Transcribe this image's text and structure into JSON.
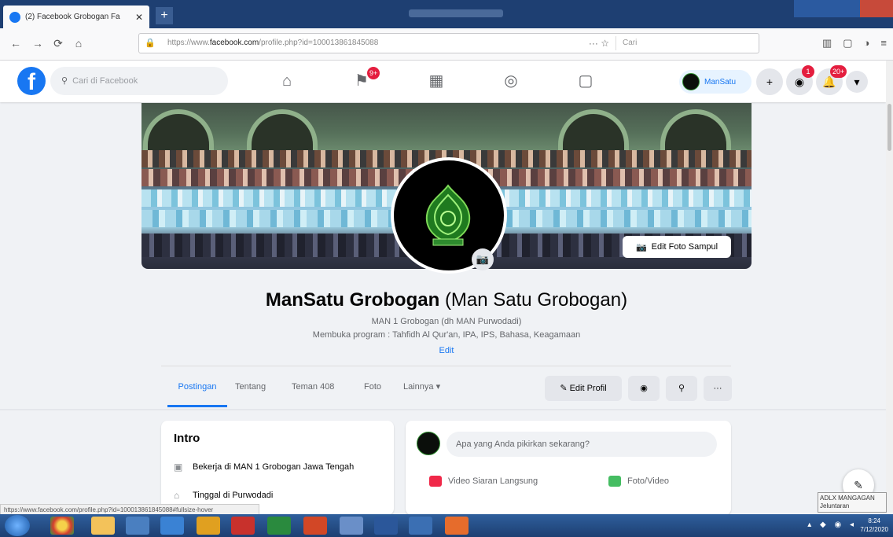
{
  "browser": {
    "tab_title": "(2) Facebook Grobogan Fa",
    "tab_close": "✕",
    "new_tab": "+",
    "url_prefix": "https://www.",
    "url_domain": "facebook.com",
    "url_path": "/profile.php?id=100013861845088",
    "url_more": "··· ☆",
    "search_placeholder": "Cari",
    "back_icon": "←",
    "forward_icon": "→",
    "reload_icon": "⟳",
    "home_icon": "⌂",
    "library_icon": "▥",
    "menu_icon": "≡"
  },
  "facebook": {
    "logo": "f",
    "search_placeholder": "Cari di Facebook",
    "nav": [
      {
        "icon": "home-icon",
        "glyph": "⌂",
        "badge": ""
      },
      {
        "icon": "flag-icon",
        "glyph": "⚑",
        "badge": "9+"
      },
      {
        "icon": "marketplace-icon",
        "glyph": "▦",
        "badge": ""
      },
      {
        "icon": "groups-icon",
        "glyph": "◎",
        "badge": ""
      },
      {
        "icon": "gaming-icon",
        "glyph": "▢",
        "badge": ""
      }
    ],
    "profile_chip_name": "ManSatu",
    "create_icon": "+",
    "messenger_badge": "1",
    "notif_badge": "20+",
    "caret": "▾"
  },
  "profile": {
    "edit_cover": "Edit Foto Sampul",
    "name_bold": "ManSatu Grobogan",
    "name_alt": "(Man Satu Grobogan)",
    "bio_line1": "MAN 1 Grobogan (dh MAN Purwodadi)",
    "bio_line2": "Membuka program : Tahfidh Al Qur'an, IPA, IPS, Bahasa, Keagamaan",
    "bio_edit": "Edit",
    "tabs": [
      "Postingan",
      "Tentang",
      "Teman 408",
      "Foto",
      "Lainnya ▾"
    ],
    "edit_profile": "✎ Edit Profil",
    "view_icon": "◉",
    "search_icon": "⚲",
    "more_icon": "···"
  },
  "intro": {
    "title": "Intro",
    "rows": [
      {
        "glyph": "▣",
        "text": "Bekerja di MAN 1 Grobogan Jawa Tengah"
      },
      {
        "glyph": "⌂",
        "text": "Tinggal di Purwodadi"
      }
    ]
  },
  "composer": {
    "placeholder": "Apa yang Anda pikirkan sekarang?",
    "action_live": "Video Siaran Langsung",
    "action_photo": "Foto/Video",
    "live_color": "#f02849",
    "photo_color": "#45bd62"
  },
  "status_url": "https://www.facebook.com/profile.php?id=100013861845088#fullsize-hover",
  "tooltip": "ADLX MANGAGAN Jeluntaran",
  "clock": {
    "time": "8:24",
    "date": "7/12/2020"
  }
}
